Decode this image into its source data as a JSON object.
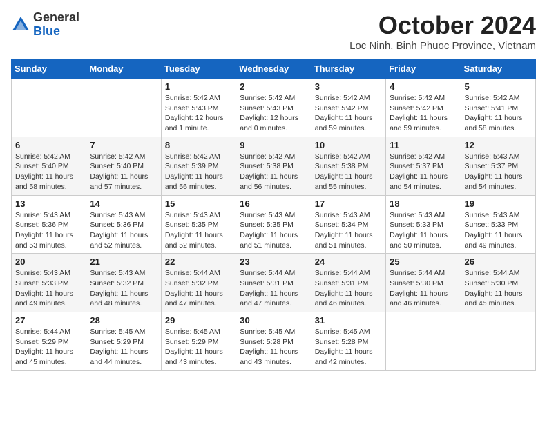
{
  "header": {
    "logo_general": "General",
    "logo_blue": "Blue",
    "month_title": "October 2024",
    "subtitle": "Loc Ninh, Binh Phuoc Province, Vietnam"
  },
  "days_of_week": [
    "Sunday",
    "Monday",
    "Tuesday",
    "Wednesday",
    "Thursday",
    "Friday",
    "Saturday"
  ],
  "weeks": [
    [
      {
        "day": "",
        "text": ""
      },
      {
        "day": "",
        "text": ""
      },
      {
        "day": "1",
        "text": "Sunrise: 5:42 AM\nSunset: 5:43 PM\nDaylight: 12 hours and 1 minute."
      },
      {
        "day": "2",
        "text": "Sunrise: 5:42 AM\nSunset: 5:43 PM\nDaylight: 12 hours and 0 minutes."
      },
      {
        "day": "3",
        "text": "Sunrise: 5:42 AM\nSunset: 5:42 PM\nDaylight: 11 hours and 59 minutes."
      },
      {
        "day": "4",
        "text": "Sunrise: 5:42 AM\nSunset: 5:42 PM\nDaylight: 11 hours and 59 minutes."
      },
      {
        "day": "5",
        "text": "Sunrise: 5:42 AM\nSunset: 5:41 PM\nDaylight: 11 hours and 58 minutes."
      }
    ],
    [
      {
        "day": "6",
        "text": "Sunrise: 5:42 AM\nSunset: 5:40 PM\nDaylight: 11 hours and 58 minutes."
      },
      {
        "day": "7",
        "text": "Sunrise: 5:42 AM\nSunset: 5:40 PM\nDaylight: 11 hours and 57 minutes."
      },
      {
        "day": "8",
        "text": "Sunrise: 5:42 AM\nSunset: 5:39 PM\nDaylight: 11 hours and 56 minutes."
      },
      {
        "day": "9",
        "text": "Sunrise: 5:42 AM\nSunset: 5:38 PM\nDaylight: 11 hours and 56 minutes."
      },
      {
        "day": "10",
        "text": "Sunrise: 5:42 AM\nSunset: 5:38 PM\nDaylight: 11 hours and 55 minutes."
      },
      {
        "day": "11",
        "text": "Sunrise: 5:42 AM\nSunset: 5:37 PM\nDaylight: 11 hours and 54 minutes."
      },
      {
        "day": "12",
        "text": "Sunrise: 5:43 AM\nSunset: 5:37 PM\nDaylight: 11 hours and 54 minutes."
      }
    ],
    [
      {
        "day": "13",
        "text": "Sunrise: 5:43 AM\nSunset: 5:36 PM\nDaylight: 11 hours and 53 minutes."
      },
      {
        "day": "14",
        "text": "Sunrise: 5:43 AM\nSunset: 5:36 PM\nDaylight: 11 hours and 52 minutes."
      },
      {
        "day": "15",
        "text": "Sunrise: 5:43 AM\nSunset: 5:35 PM\nDaylight: 11 hours and 52 minutes."
      },
      {
        "day": "16",
        "text": "Sunrise: 5:43 AM\nSunset: 5:35 PM\nDaylight: 11 hours and 51 minutes."
      },
      {
        "day": "17",
        "text": "Sunrise: 5:43 AM\nSunset: 5:34 PM\nDaylight: 11 hours and 51 minutes."
      },
      {
        "day": "18",
        "text": "Sunrise: 5:43 AM\nSunset: 5:33 PM\nDaylight: 11 hours and 50 minutes."
      },
      {
        "day": "19",
        "text": "Sunrise: 5:43 AM\nSunset: 5:33 PM\nDaylight: 11 hours and 49 minutes."
      }
    ],
    [
      {
        "day": "20",
        "text": "Sunrise: 5:43 AM\nSunset: 5:33 PM\nDaylight: 11 hours and 49 minutes."
      },
      {
        "day": "21",
        "text": "Sunrise: 5:43 AM\nSunset: 5:32 PM\nDaylight: 11 hours and 48 minutes."
      },
      {
        "day": "22",
        "text": "Sunrise: 5:44 AM\nSunset: 5:32 PM\nDaylight: 11 hours and 47 minutes."
      },
      {
        "day": "23",
        "text": "Sunrise: 5:44 AM\nSunset: 5:31 PM\nDaylight: 11 hours and 47 minutes."
      },
      {
        "day": "24",
        "text": "Sunrise: 5:44 AM\nSunset: 5:31 PM\nDaylight: 11 hours and 46 minutes."
      },
      {
        "day": "25",
        "text": "Sunrise: 5:44 AM\nSunset: 5:30 PM\nDaylight: 11 hours and 46 minutes."
      },
      {
        "day": "26",
        "text": "Sunrise: 5:44 AM\nSunset: 5:30 PM\nDaylight: 11 hours and 45 minutes."
      }
    ],
    [
      {
        "day": "27",
        "text": "Sunrise: 5:44 AM\nSunset: 5:29 PM\nDaylight: 11 hours and 45 minutes."
      },
      {
        "day": "28",
        "text": "Sunrise: 5:45 AM\nSunset: 5:29 PM\nDaylight: 11 hours and 44 minutes."
      },
      {
        "day": "29",
        "text": "Sunrise: 5:45 AM\nSunset: 5:29 PM\nDaylight: 11 hours and 43 minutes."
      },
      {
        "day": "30",
        "text": "Sunrise: 5:45 AM\nSunset: 5:28 PM\nDaylight: 11 hours and 43 minutes."
      },
      {
        "day": "31",
        "text": "Sunrise: 5:45 AM\nSunset: 5:28 PM\nDaylight: 11 hours and 42 minutes."
      },
      {
        "day": "",
        "text": ""
      },
      {
        "day": "",
        "text": ""
      }
    ]
  ]
}
